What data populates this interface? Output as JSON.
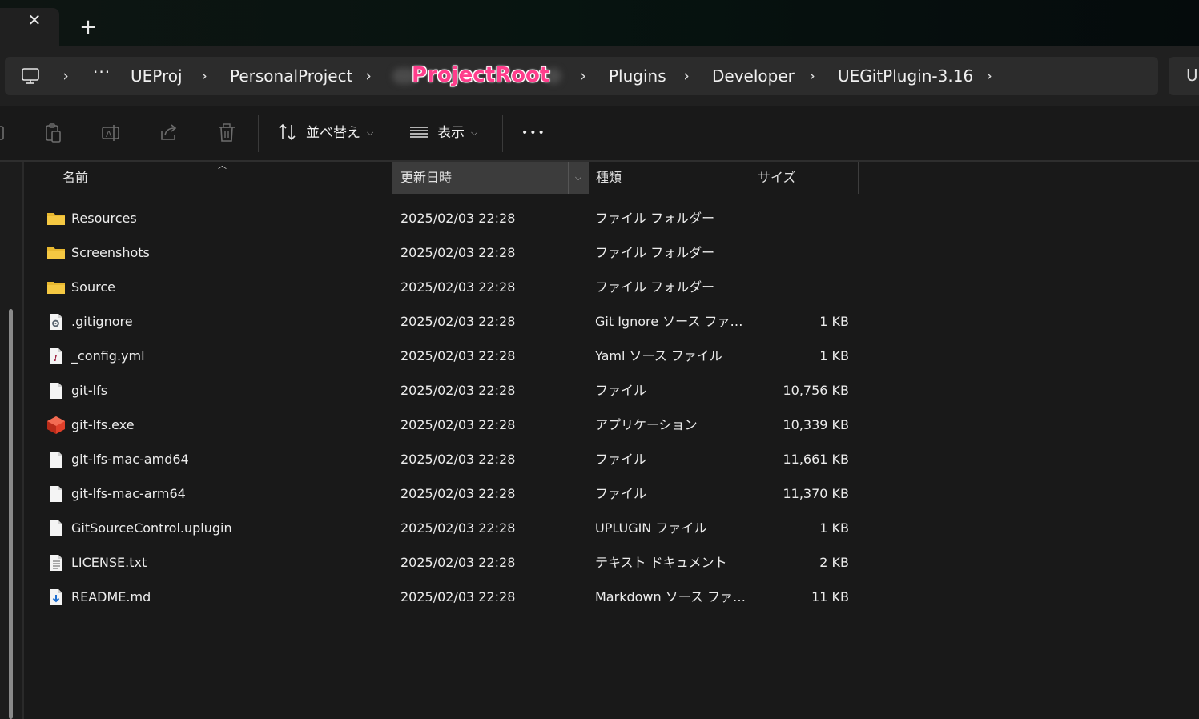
{
  "tabbar": {
    "close_glyph": "✕",
    "new_tab_glyph": "+"
  },
  "breadcrumb": {
    "overflow_label": "···",
    "items": [
      {
        "label": "UEProj"
      },
      {
        "label": "PersonalProject"
      },
      {
        "label": "ProjectRoot",
        "highlight": true
      },
      {
        "label": "Plugins"
      },
      {
        "label": "Developer"
      },
      {
        "label": "UEGitPlugin-3.16"
      }
    ],
    "highlight_color": "#ff3e8c"
  },
  "search": {
    "visible_text": "U"
  },
  "toolbar": {
    "icons": [
      "copy-icon",
      "paste-icon",
      "rename-icon",
      "share-icon",
      "delete-icon"
    ],
    "sort_label": "並べ替え",
    "view_label": "表示",
    "more_glyph": "•••"
  },
  "columns": {
    "name": "名前",
    "date": "更新日時",
    "type": "種類",
    "size": "サイズ"
  },
  "files": [
    {
      "name": "Resources",
      "date": "2025/02/03 22:28",
      "type": "ファイル フォルダー",
      "size": "",
      "icon": "folder-icon"
    },
    {
      "name": "Screenshots",
      "date": "2025/02/03 22:28",
      "type": "ファイル フォルダー",
      "size": "",
      "icon": "folder-icon"
    },
    {
      "name": "Source",
      "date": "2025/02/03 22:28",
      "type": "ファイル フォルダー",
      "size": "",
      "icon": "folder-icon"
    },
    {
      "name": ".gitignore",
      "date": "2025/02/03 22:28",
      "type": "Git Ignore ソース ファイル",
      "size": "1 KB",
      "icon": "config-file-icon"
    },
    {
      "name": "_config.yml",
      "date": "2025/02/03 22:28",
      "type": "Yaml ソース ファイル",
      "size": "1 KB",
      "icon": "yaml-file-icon"
    },
    {
      "name": "git-lfs",
      "date": "2025/02/03 22:28",
      "type": "ファイル",
      "size": "10,756 KB",
      "icon": "file-icon"
    },
    {
      "name": "git-lfs.exe",
      "date": "2025/02/03 22:28",
      "type": "アプリケーション",
      "size": "10,339 KB",
      "icon": "git-lfs-app-icon"
    },
    {
      "name": "git-lfs-mac-amd64",
      "date": "2025/02/03 22:28",
      "type": "ファイル",
      "size": "11,661 KB",
      "icon": "file-icon"
    },
    {
      "name": "git-lfs-mac-arm64",
      "date": "2025/02/03 22:28",
      "type": "ファイル",
      "size": "11,370 KB",
      "icon": "file-icon"
    },
    {
      "name": "GitSourceControl.uplugin",
      "date": "2025/02/03 22:28",
      "type": "UPLUGIN ファイル",
      "size": "1 KB",
      "icon": "file-icon"
    },
    {
      "name": "LICENSE.txt",
      "date": "2025/02/03 22:28",
      "type": "テキスト ドキュメント",
      "size": "2 KB",
      "icon": "text-file-icon"
    },
    {
      "name": "README.md",
      "date": "2025/02/03 22:28",
      "type": "Markdown ソース ファイ...",
      "size": "11 KB",
      "icon": "markdown-file-icon"
    }
  ]
}
